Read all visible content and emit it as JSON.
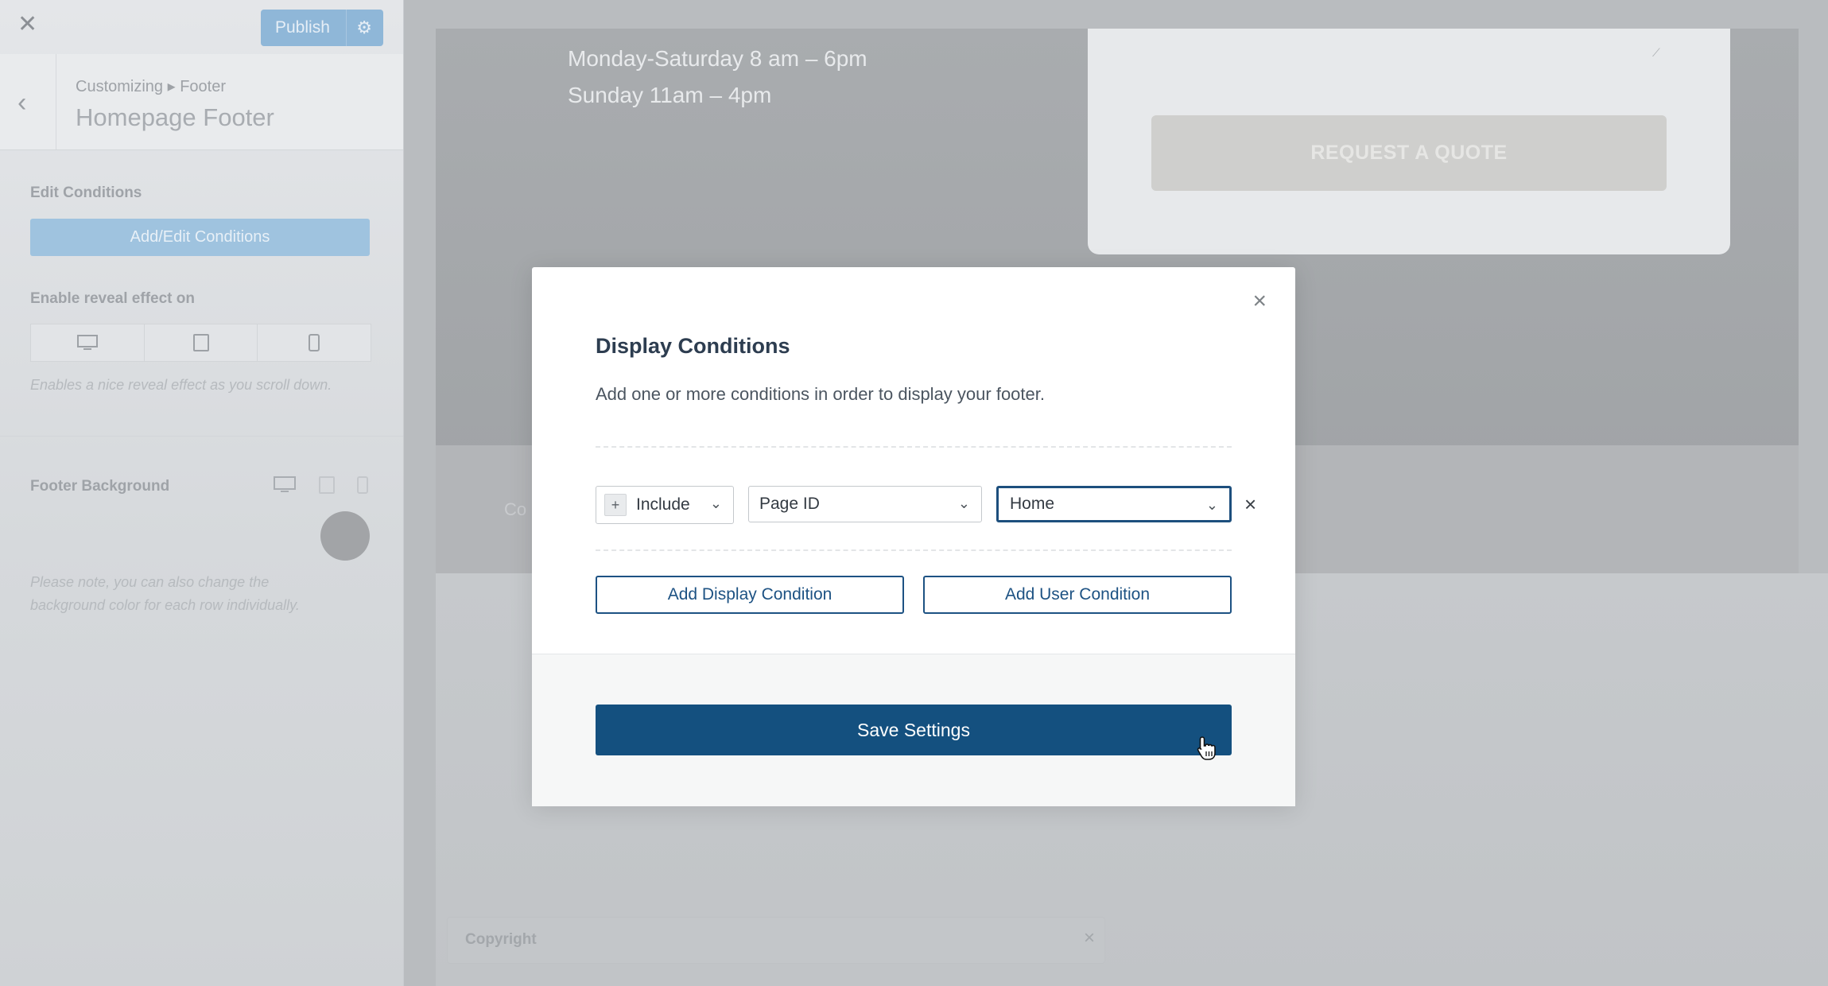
{
  "sidebar": {
    "publish_label": "Publish",
    "breadcrumb": "Customizing ▸ Footer",
    "title": "Homepage Footer",
    "edit_conditions_label": "Edit Conditions",
    "add_edit_button": "Add/Edit Conditions",
    "reveal_label": "Enable reveal effect on",
    "reveal_note": "Enables a nice reveal effect as you scroll down.",
    "footer_bg_label": "Footer Background",
    "bg_note_line1": "Please note, you can also change the",
    "bg_note_line2": "background color for each row individually."
  },
  "preview": {
    "hours_line1": "Monday-Saturday 8 am – 6pm",
    "hours_line2": "Sunday 11am – 4pm",
    "quote_button": "REQUEST A QUOTE",
    "band_text": "Co",
    "copyright_label": "Copyright"
  },
  "modal": {
    "title": "Display Conditions",
    "description": "Add one or more conditions in order to display your footer.",
    "condition": {
      "mode": "Include",
      "type": "Page ID",
      "value": "Home"
    },
    "add_display_condition": "Add Display Condition",
    "add_user_condition": "Add User Condition",
    "save_button": "Save Settings"
  },
  "colors": {
    "primary": "#14507f",
    "accent_outline": "#1d5283"
  }
}
